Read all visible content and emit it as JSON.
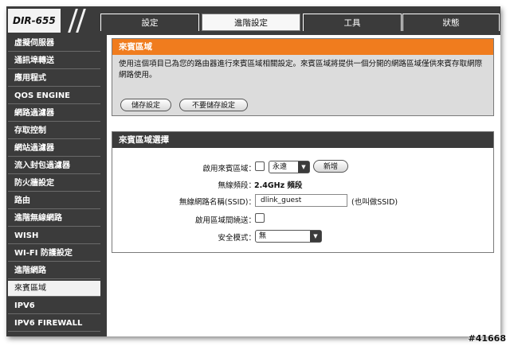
{
  "logo": "DIR-655",
  "tabs": [
    {
      "label": "設定",
      "active": false
    },
    {
      "label": "進階設定",
      "active": true
    },
    {
      "label": "工具",
      "active": false
    },
    {
      "label": "狀態",
      "active": false
    }
  ],
  "sidebar": {
    "items": [
      {
        "label": "虛擬伺服器",
        "active": false
      },
      {
        "label": "通訊埠轉送",
        "active": false
      },
      {
        "label": "應用程式",
        "active": false
      },
      {
        "label": "QOS ENGINE",
        "active": false
      },
      {
        "label": "網路過濾器",
        "active": false
      },
      {
        "label": "存取控制",
        "active": false
      },
      {
        "label": "網站過濾器",
        "active": false
      },
      {
        "label": "流入封包過濾器",
        "active": false
      },
      {
        "label": "防火牆設定",
        "active": false
      },
      {
        "label": "路由",
        "active": false
      },
      {
        "label": "進階無線網路",
        "active": false
      },
      {
        "label": "WISH",
        "active": false
      },
      {
        "label": "WI-FI 防護設定",
        "active": false
      },
      {
        "label": "進階網路",
        "active": false
      },
      {
        "label": "來賓區域",
        "active": true
      },
      {
        "label": "IPV6",
        "active": false
      },
      {
        "label": "IPV6 FIREWALL",
        "active": false
      }
    ]
  },
  "intro": {
    "title": "來賓區域",
    "text": "使用這個項目已為您的路由器進行來賓區域相關設定。來賓區域將提供一個分開的網路區域僅供來賓存取網際網路使用。",
    "save_label": "儲存設定",
    "dont_save_label": "不要儲存設定"
  },
  "selection": {
    "title": "來賓區域選擇",
    "enable_label": "啟用來賓區域：",
    "schedule_value": "永遠",
    "add_new_label": "新增",
    "band_label": "無線頻段：",
    "band_value": "2.4GHz 頻段",
    "ssid_label": "無線網路名稱(SSID)：",
    "ssid_value": "dlink_guest",
    "ssid_hint": "(也叫做SSID)",
    "routing_label": "啟用區域間繞送：",
    "security_label": "安全模式：",
    "security_value": "無"
  },
  "watermark": "#41668",
  "colors": {
    "orange": "#f07c1e",
    "dark": "#3b3b3b"
  }
}
